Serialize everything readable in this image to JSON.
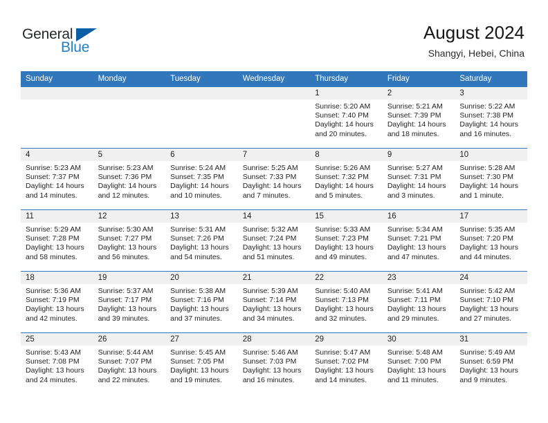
{
  "brand": {
    "name_part1": "General",
    "name_part2": "Blue",
    "triangle_color": "#0b5fa4",
    "blue_color": "#2180c4"
  },
  "header": {
    "title": "August 2024",
    "location": "Shangyi, Hebei, China"
  },
  "theme": {
    "header_bg": "#3177bb",
    "daynum_bg": "#f0f0f0",
    "cell_border": "#3177bb"
  },
  "weekdays": [
    "Sunday",
    "Monday",
    "Tuesday",
    "Wednesday",
    "Thursday",
    "Friday",
    "Saturday"
  ],
  "labels": {
    "sunrise": "Sunrise:",
    "sunset": "Sunset:",
    "daylight": "Daylight:"
  },
  "weeks": [
    [
      {
        "day": "",
        "empty": true
      },
      {
        "day": "",
        "empty": true
      },
      {
        "day": "",
        "empty": true
      },
      {
        "day": "",
        "empty": true
      },
      {
        "day": "1",
        "sunrise": "Sunrise: 5:20 AM",
        "sunset": "Sunset: 7:40 PM",
        "daylight1": "Daylight: 14 hours",
        "daylight2": "and 20 minutes."
      },
      {
        "day": "2",
        "sunrise": "Sunrise: 5:21 AM",
        "sunset": "Sunset: 7:39 PM",
        "daylight1": "Daylight: 14 hours",
        "daylight2": "and 18 minutes."
      },
      {
        "day": "3",
        "sunrise": "Sunrise: 5:22 AM",
        "sunset": "Sunset: 7:38 PM",
        "daylight1": "Daylight: 14 hours",
        "daylight2": "and 16 minutes."
      }
    ],
    [
      {
        "day": "4",
        "sunrise": "Sunrise: 5:23 AM",
        "sunset": "Sunset: 7:37 PM",
        "daylight1": "Daylight: 14 hours",
        "daylight2": "and 14 minutes."
      },
      {
        "day": "5",
        "sunrise": "Sunrise: 5:23 AM",
        "sunset": "Sunset: 7:36 PM",
        "daylight1": "Daylight: 14 hours",
        "daylight2": "and 12 minutes."
      },
      {
        "day": "6",
        "sunrise": "Sunrise: 5:24 AM",
        "sunset": "Sunset: 7:35 PM",
        "daylight1": "Daylight: 14 hours",
        "daylight2": "and 10 minutes."
      },
      {
        "day": "7",
        "sunrise": "Sunrise: 5:25 AM",
        "sunset": "Sunset: 7:33 PM",
        "daylight1": "Daylight: 14 hours",
        "daylight2": "and 7 minutes."
      },
      {
        "day": "8",
        "sunrise": "Sunrise: 5:26 AM",
        "sunset": "Sunset: 7:32 PM",
        "daylight1": "Daylight: 14 hours",
        "daylight2": "and 5 minutes."
      },
      {
        "day": "9",
        "sunrise": "Sunrise: 5:27 AM",
        "sunset": "Sunset: 7:31 PM",
        "daylight1": "Daylight: 14 hours",
        "daylight2": "and 3 minutes."
      },
      {
        "day": "10",
        "sunrise": "Sunrise: 5:28 AM",
        "sunset": "Sunset: 7:30 PM",
        "daylight1": "Daylight: 14 hours",
        "daylight2": "and 1 minute."
      }
    ],
    [
      {
        "day": "11",
        "sunrise": "Sunrise: 5:29 AM",
        "sunset": "Sunset: 7:28 PM",
        "daylight1": "Daylight: 13 hours",
        "daylight2": "and 58 minutes."
      },
      {
        "day": "12",
        "sunrise": "Sunrise: 5:30 AM",
        "sunset": "Sunset: 7:27 PM",
        "daylight1": "Daylight: 13 hours",
        "daylight2": "and 56 minutes."
      },
      {
        "day": "13",
        "sunrise": "Sunrise: 5:31 AM",
        "sunset": "Sunset: 7:26 PM",
        "daylight1": "Daylight: 13 hours",
        "daylight2": "and 54 minutes."
      },
      {
        "day": "14",
        "sunrise": "Sunrise: 5:32 AM",
        "sunset": "Sunset: 7:24 PM",
        "daylight1": "Daylight: 13 hours",
        "daylight2": "and 51 minutes."
      },
      {
        "day": "15",
        "sunrise": "Sunrise: 5:33 AM",
        "sunset": "Sunset: 7:23 PM",
        "daylight1": "Daylight: 13 hours",
        "daylight2": "and 49 minutes."
      },
      {
        "day": "16",
        "sunrise": "Sunrise: 5:34 AM",
        "sunset": "Sunset: 7:21 PM",
        "daylight1": "Daylight: 13 hours",
        "daylight2": "and 47 minutes."
      },
      {
        "day": "17",
        "sunrise": "Sunrise: 5:35 AM",
        "sunset": "Sunset: 7:20 PM",
        "daylight1": "Daylight: 13 hours",
        "daylight2": "and 44 minutes."
      }
    ],
    [
      {
        "day": "18",
        "sunrise": "Sunrise: 5:36 AM",
        "sunset": "Sunset: 7:19 PM",
        "daylight1": "Daylight: 13 hours",
        "daylight2": "and 42 minutes."
      },
      {
        "day": "19",
        "sunrise": "Sunrise: 5:37 AM",
        "sunset": "Sunset: 7:17 PM",
        "daylight1": "Daylight: 13 hours",
        "daylight2": "and 39 minutes."
      },
      {
        "day": "20",
        "sunrise": "Sunrise: 5:38 AM",
        "sunset": "Sunset: 7:16 PM",
        "daylight1": "Daylight: 13 hours",
        "daylight2": "and 37 minutes."
      },
      {
        "day": "21",
        "sunrise": "Sunrise: 5:39 AM",
        "sunset": "Sunset: 7:14 PM",
        "daylight1": "Daylight: 13 hours",
        "daylight2": "and 34 minutes."
      },
      {
        "day": "22",
        "sunrise": "Sunrise: 5:40 AM",
        "sunset": "Sunset: 7:13 PM",
        "daylight1": "Daylight: 13 hours",
        "daylight2": "and 32 minutes."
      },
      {
        "day": "23",
        "sunrise": "Sunrise: 5:41 AM",
        "sunset": "Sunset: 7:11 PM",
        "daylight1": "Daylight: 13 hours",
        "daylight2": "and 29 minutes."
      },
      {
        "day": "24",
        "sunrise": "Sunrise: 5:42 AM",
        "sunset": "Sunset: 7:10 PM",
        "daylight1": "Daylight: 13 hours",
        "daylight2": "and 27 minutes."
      }
    ],
    [
      {
        "day": "25",
        "sunrise": "Sunrise: 5:43 AM",
        "sunset": "Sunset: 7:08 PM",
        "daylight1": "Daylight: 13 hours",
        "daylight2": "and 24 minutes."
      },
      {
        "day": "26",
        "sunrise": "Sunrise: 5:44 AM",
        "sunset": "Sunset: 7:07 PM",
        "daylight1": "Daylight: 13 hours",
        "daylight2": "and 22 minutes."
      },
      {
        "day": "27",
        "sunrise": "Sunrise: 5:45 AM",
        "sunset": "Sunset: 7:05 PM",
        "daylight1": "Daylight: 13 hours",
        "daylight2": "and 19 minutes."
      },
      {
        "day": "28",
        "sunrise": "Sunrise: 5:46 AM",
        "sunset": "Sunset: 7:03 PM",
        "daylight1": "Daylight: 13 hours",
        "daylight2": "and 16 minutes."
      },
      {
        "day": "29",
        "sunrise": "Sunrise: 5:47 AM",
        "sunset": "Sunset: 7:02 PM",
        "daylight1": "Daylight: 13 hours",
        "daylight2": "and 14 minutes."
      },
      {
        "day": "30",
        "sunrise": "Sunrise: 5:48 AM",
        "sunset": "Sunset: 7:00 PM",
        "daylight1": "Daylight: 13 hours",
        "daylight2": "and 11 minutes."
      },
      {
        "day": "31",
        "sunrise": "Sunrise: 5:49 AM",
        "sunset": "Sunset: 6:59 PM",
        "daylight1": "Daylight: 13 hours",
        "daylight2": "and 9 minutes."
      }
    ]
  ]
}
